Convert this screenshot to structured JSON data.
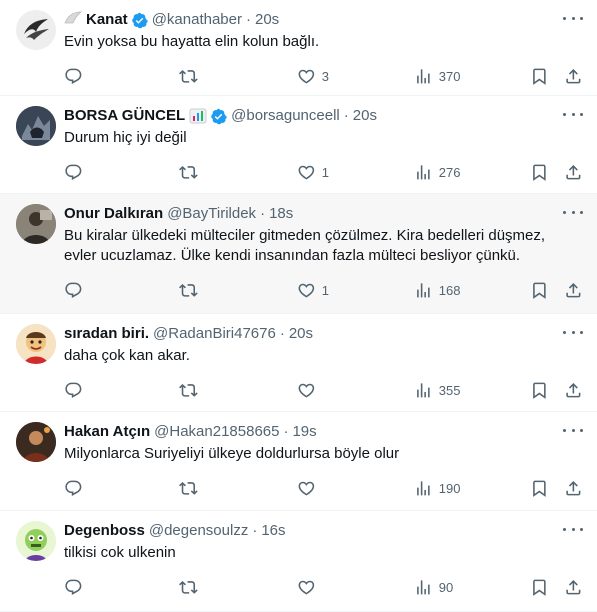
{
  "tweets": [
    {
      "name": "Kanat",
      "prefix_emoji": "wing",
      "verified": true,
      "handle": "@kanathaber",
      "time": "20s",
      "text": "Evin yoksa bu hayatta elin kolun bağlı.",
      "likes": "3",
      "views": "370",
      "highlighted": false
    },
    {
      "name": "BORSA GÜNCEL",
      "suffix_emoji": "chart",
      "verified": true,
      "handle": "@borsagunceell",
      "time": "20s",
      "text": "Durum hiç iyi değil",
      "likes": "1",
      "views": "276",
      "highlighted": false
    },
    {
      "name": "Onur Dalkıran",
      "verified": false,
      "handle": "@BayTirildek",
      "time": "18s",
      "text": "Bu kiralar ülkedeki mülteciler gitmeden çözülmez. Kira bedelleri düşmez, evler ucuzlamaz. Ülke kendi insanından fazla mülteci besliyor çünkü.",
      "likes": "1",
      "views": "168",
      "highlighted": true
    },
    {
      "name": "sıradan biri.",
      "verified": false,
      "handle": "@RadanBiri47676",
      "time": "20s",
      "text": "daha çok kan akar.",
      "likes": "",
      "views": "355",
      "highlighted": false
    },
    {
      "name": "Hakan Atçın",
      "verified": false,
      "handle": "@Hakan21858665",
      "time": "19s",
      "text": "Milyonlarca Suriyeliyi ülkeye doldurlursa böyle olur",
      "likes": "",
      "views": "190",
      "highlighted": false
    },
    {
      "name": "Degenboss",
      "verified": false,
      "handle": "@degensoulzz",
      "time": "16s",
      "text": "tilkisi cok ulkenin",
      "likes": "",
      "views": "90",
      "highlighted": false
    }
  ],
  "separator": "·",
  "icons": {
    "reply": "reply-icon",
    "retweet": "retweet-icon",
    "like": "heart-icon",
    "views": "views-icon",
    "bookmark": "bookmark-icon",
    "share": "share-icon",
    "more": "more-icon",
    "verified": "verified-badge-icon"
  },
  "colors": {
    "text": "#0f1419",
    "secondary": "#536471",
    "verified": "#1d9bf0",
    "highlight_bg": "#f7f7f7",
    "border": "#eff3f4"
  }
}
